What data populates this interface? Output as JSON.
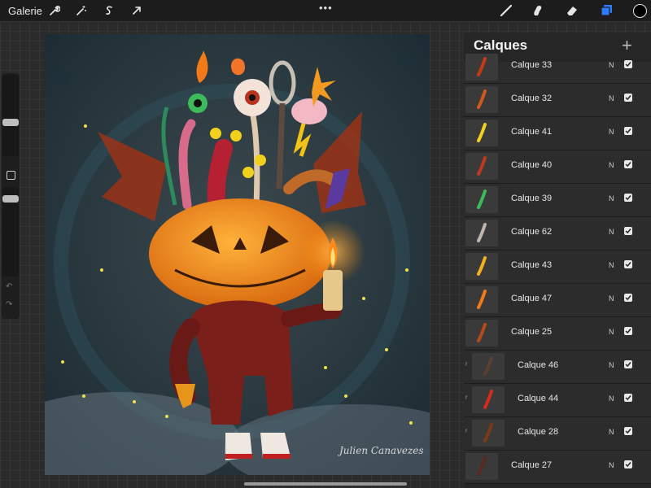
{
  "topbar": {
    "gallery_label": "Galerie",
    "dots": "•••",
    "tools": [
      "wrench-icon",
      "magic-wand-icon",
      "selection-s-icon",
      "arrow-transform-icon"
    ],
    "right_tools": [
      "brush-icon",
      "smudge-icon",
      "eraser-icon",
      "layers-icon"
    ],
    "color": "#000000",
    "accent": "#2f7bff"
  },
  "sidebar": {
    "undo_icon": "↶",
    "redo_icon": "↷"
  },
  "canvas": {
    "signature": "Julien Canavezes"
  },
  "panel": {
    "title": "Calques",
    "add_icon": "+",
    "layers": [
      {
        "name": "Calque 33",
        "mode": "N",
        "visible": true,
        "indent": false
      },
      {
        "name": "Calque 32",
        "mode": "N",
        "visible": true,
        "indent": false
      },
      {
        "name": "Calque 41",
        "mode": "N",
        "visible": true,
        "indent": false
      },
      {
        "name": "Calque 40",
        "mode": "N",
        "visible": true,
        "indent": false
      },
      {
        "name": "Calque 39",
        "mode": "N",
        "visible": true,
        "indent": false
      },
      {
        "name": "Calque 62",
        "mode": "N",
        "visible": true,
        "indent": false
      },
      {
        "name": "Calque 43",
        "mode": "N",
        "visible": true,
        "indent": false
      },
      {
        "name": "Calque 47",
        "mode": "N",
        "visible": true,
        "indent": false
      },
      {
        "name": "Calque 25",
        "mode": "N",
        "visible": true,
        "indent": false
      },
      {
        "name": "Calque 46",
        "mode": "N",
        "visible": true,
        "indent": true
      },
      {
        "name": "Calque 44",
        "mode": "N",
        "visible": true,
        "indent": true
      },
      {
        "name": "Calque 28",
        "mode": "N",
        "visible": true,
        "indent": true
      },
      {
        "name": "Calque 27",
        "mode": "N",
        "visible": true,
        "indent": false
      }
    ]
  }
}
